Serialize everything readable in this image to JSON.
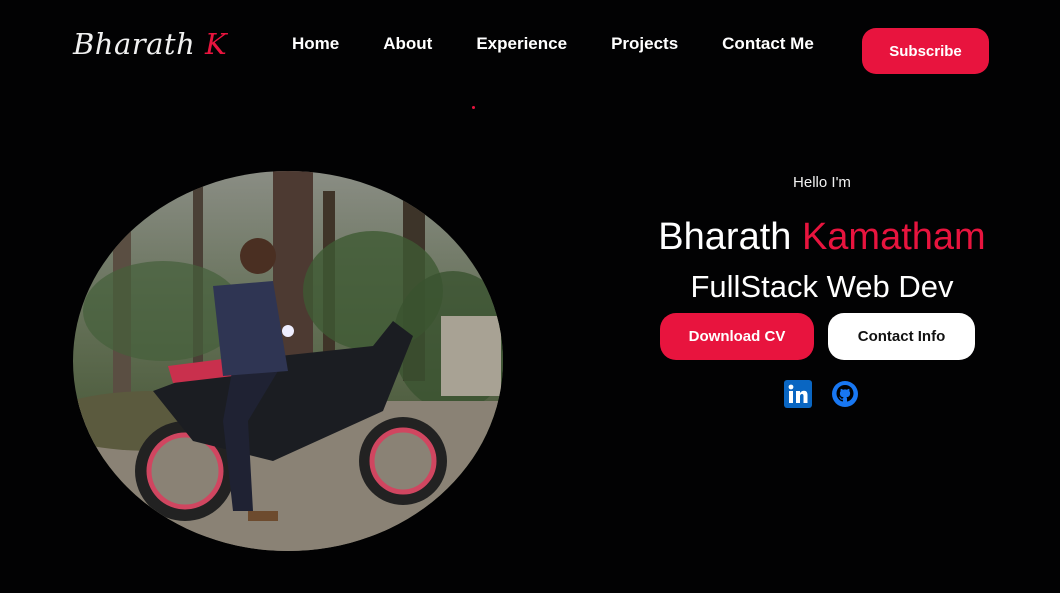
{
  "header": {
    "logo_first": "Bharath",
    "logo_accent": "K",
    "nav": [
      "Home",
      "About",
      "Experience",
      "Projects",
      "Contact Me"
    ],
    "subscribe_label": "Subscribe"
  },
  "hero": {
    "greeting": "Hello I'm",
    "first_name": "Bharath",
    "last_name": "Kamatham",
    "role": "FullStack Web Dev",
    "download_cv_label": "Download CV",
    "contact_info_label": "Contact Info",
    "socials": [
      "linkedin-icon",
      "github-icon"
    ]
  },
  "colors": {
    "accent": "#e8143e",
    "background": "#020203",
    "linkedin": "#0a66c2",
    "github": "#1877f2"
  }
}
